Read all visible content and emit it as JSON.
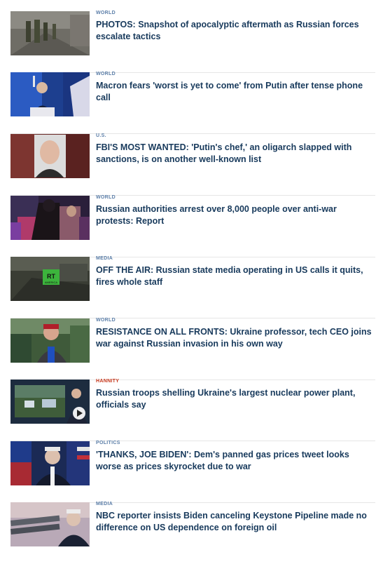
{
  "items": [
    {
      "category": "WORLD",
      "headline": "PHOTOS: Snapshot of apocalyptic aftermath as Russian forces escalate tactics",
      "image": "soldiers-street-photo"
    },
    {
      "category": "WORLD",
      "headline": "Macron fears 'worst is yet to come' from Putin after tense phone call",
      "image": "macron-podium-photo"
    },
    {
      "category": "U.S.",
      "headline": "FBI'S MOST WANTED: 'Putin's chef,' an oligarch slapped with sanctions, is on another well-known list",
      "image": "oligarch-portrait-photo"
    },
    {
      "category": "WORLD",
      "headline": "Russian authorities arrest over 8,000 people over anti-war protests: Report",
      "image": "protest-arrest-photo"
    },
    {
      "category": "MEDIA",
      "headline": "OFF THE AIR: Russian state media operating in US calls it quits, fires whole staff",
      "image": "rt-america-logo-photo"
    },
    {
      "category": "WORLD",
      "headline": "RESISTANCE ON ALL FRONTS: Ukraine professor, tech CEO joins war against Russian invasion in his own way",
      "image": "professor-selfie-photo"
    },
    {
      "category": "HANNITY",
      "headline": "Russian troops shelling Ukraine's largest nuclear power plant, officials say",
      "image": "hannity-video-thumbnail"
    },
    {
      "category": "POLITICS",
      "headline": "'THANKS, JOE BIDEN': Dem's panned gas prices tweet looks worse as prices skyrocket due to war",
      "image": "biden-flags-photo"
    },
    {
      "category": "MEDIA",
      "headline": "NBC reporter insists Biden canceling Keystone Pipeline made no difference on US dependence on foreign oil",
      "image": "biden-pipeline-photo"
    }
  ],
  "colors": {
    "kicker": "#5b7ea8",
    "kicker_hannity": "#c8371b",
    "headline": "#183a5c",
    "divider": "#e6e6e6"
  },
  "thumb_overlays": {
    "rt_logo": "RT",
    "rt_sub": "AMERICA"
  }
}
